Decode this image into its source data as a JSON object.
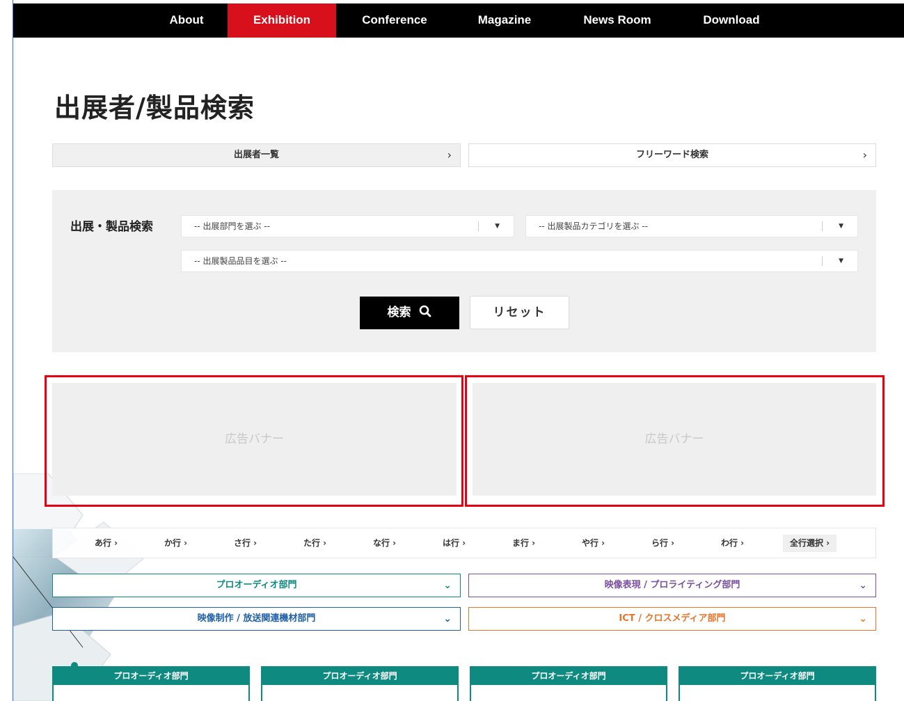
{
  "nav": {
    "items": [
      {
        "label": "About"
      },
      {
        "label": "Exhibition"
      },
      {
        "label": "Conference"
      },
      {
        "label": "Magazine"
      },
      {
        "label": "News Room"
      },
      {
        "label": "Download"
      }
    ],
    "active_index": 1,
    "active_color": "#d8101c"
  },
  "page": {
    "title": "出展者/製品検索"
  },
  "tabs": [
    {
      "label": "出展者一覧",
      "chevron": "›"
    },
    {
      "label": "フリーワード検索",
      "chevron": "›"
    }
  ],
  "search": {
    "label": "出展・製品検索",
    "select_division": "-- 出展部門を選ぶ --",
    "select_category": "-- 出展製品カテゴリを選ぶ --",
    "select_item": "-- 出展製品品目を選ぶ --",
    "search_button": "検索",
    "reset_button": "リセット"
  },
  "banners": [
    {
      "label": "広告バナー"
    },
    {
      "label": "広告バナー"
    }
  ],
  "kana": {
    "items": [
      "あ行 ›",
      "か行 ›",
      "さ行 ›",
      "た行 ›",
      "な行 ›",
      "は行 ›",
      "ま行 ›",
      "や行 ›",
      "ら行 ›",
      "わ行 ›"
    ],
    "all": "全行選択 ›"
  },
  "categories": [
    {
      "label": "プロオーディオ部門",
      "color": "#0e8a80"
    },
    {
      "label": "映像表現 / プロライティング部門",
      "color": "#7a4fa0"
    },
    {
      "label": "映像制作 / 放送関連機材部門",
      "color": "#1e5fa8"
    },
    {
      "label": "ICT / クロスメディア部門",
      "color": "#e8742a"
    }
  ],
  "cards": [
    {
      "label": "プロオーディオ部門"
    },
    {
      "label": "プロオーディオ部門"
    },
    {
      "label": "プロオーディオ部門"
    },
    {
      "label": "プロオーディオ部門"
    }
  ]
}
